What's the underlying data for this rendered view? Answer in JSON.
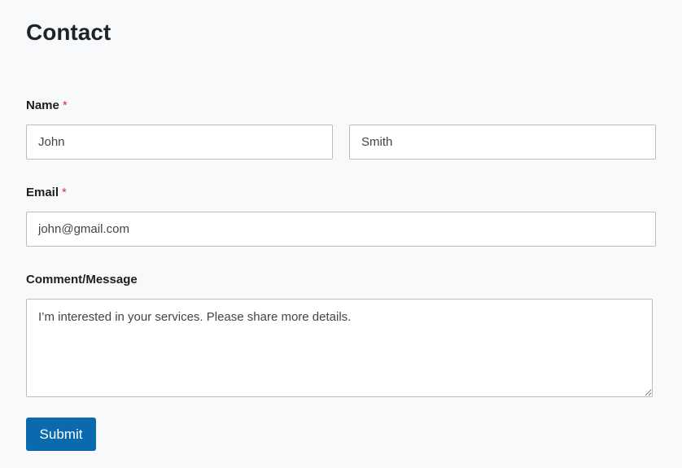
{
  "page": {
    "title": "Contact"
  },
  "form": {
    "name": {
      "label": "Name",
      "required_mark": "*",
      "first": "John",
      "last": "Smith"
    },
    "email": {
      "label": "Email",
      "required_mark": "*",
      "value": "john@gmail.com"
    },
    "message": {
      "label": "Comment/Message",
      "value": "I’m interested in your services. Please share more details."
    },
    "submit_label": "Submit"
  },
  "colors": {
    "accent": "#0a6aad",
    "required": "#d63638"
  }
}
